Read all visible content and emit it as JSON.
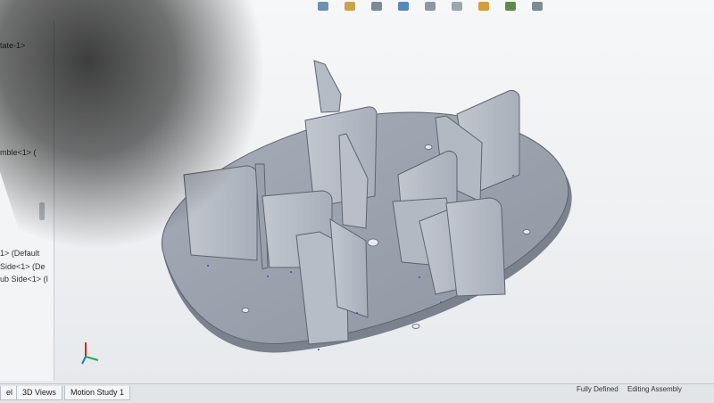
{
  "left_panel": {
    "items": [
      "tate-1>",
      "mble<1> (",
      "1> (Default",
      "Side<1> (De",
      "ub Side<1> (I"
    ]
  },
  "bottom_tabs": {
    "tab_partial": "el",
    "tab_3d_views": "3D Views",
    "tab_motion_study": "Motion Study 1"
  },
  "status_bar": {
    "fully_defined": "Fully Defined",
    "editing_assembly": "Editing Assembly"
  },
  "colors": {
    "part_face": "#aeb4bf",
    "part_top": "#9aa1ad",
    "part_edge": "#5e6470",
    "background": "#eef0f2"
  },
  "icons": [
    "toolbar-icons",
    "triad-icon"
  ]
}
